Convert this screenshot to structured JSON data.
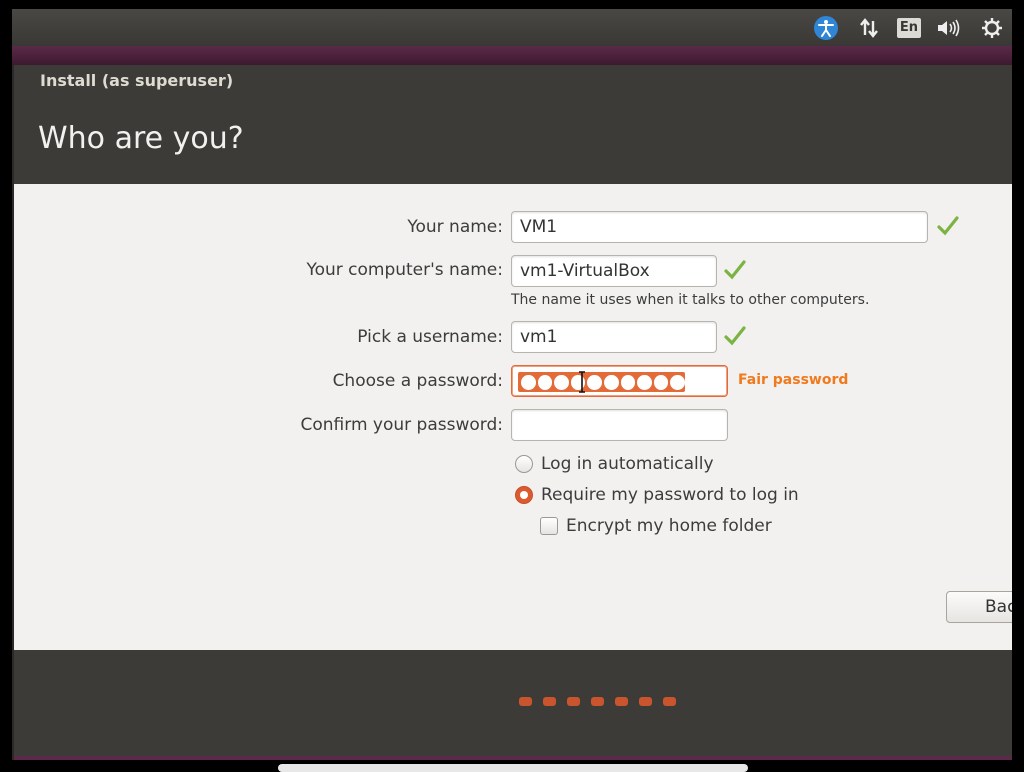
{
  "window": {
    "title": "Install (as superuser)",
    "heading": "Who are you?"
  },
  "panel": {
    "indicators": [
      "accessibility-icon",
      "network-icon",
      "keyboard-layout-indicator",
      "volume-icon",
      "power-gear-icon"
    ],
    "keyboard_layout": "En"
  },
  "form": {
    "name_label": "Your name:",
    "name_value": "VM1",
    "computer_label": "Your computer's name:",
    "computer_value": "vm1-VirtualBox",
    "computer_hint": "The name it uses when it talks to other computers.",
    "username_label": "Pick a username:",
    "username_value": "vm1",
    "password_label": "Choose a password:",
    "password_mask_length": 10,
    "password_strength": "Fair password",
    "confirm_label": "Confirm your password:",
    "confirm_value": "",
    "login_auto_label": "Log in automatically",
    "login_require_label": "Require my password to log in",
    "login_selected": "require",
    "encrypt_label": "Encrypt my home folder",
    "encrypt_checked": false
  },
  "buttons": {
    "back_label": "Back"
  },
  "progress": {
    "total_steps": 7
  },
  "colors": {
    "accent": "#dd5a2e",
    "strength": "#f07a1c",
    "valid_check": "#7cb342"
  }
}
